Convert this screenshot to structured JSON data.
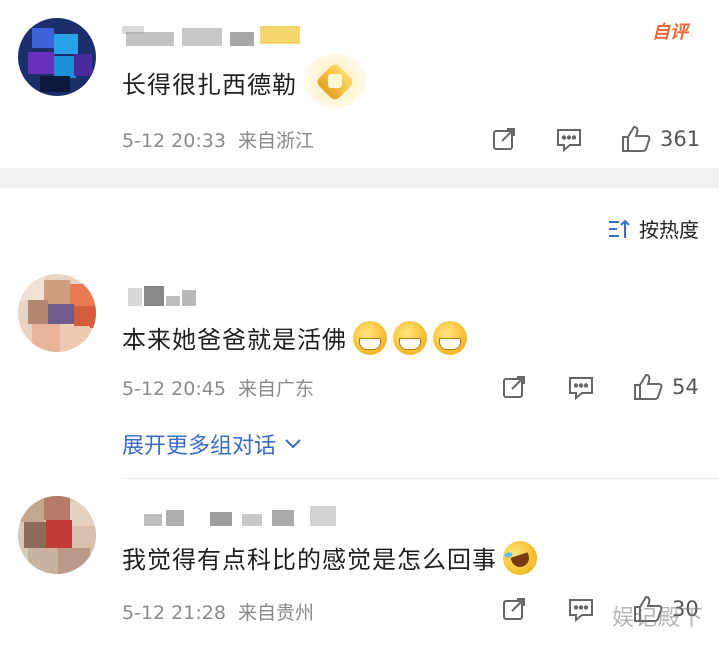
{
  "comments": [
    {
      "text": "长得很扎西德勒",
      "time": "5-12 20:33",
      "location": "来自浙江",
      "likes": "361",
      "hot_label": "自评"
    },
    {
      "text": "本来她爸爸就是活佛",
      "time": "5-12 20:45",
      "location": "来自广东",
      "likes": "54",
      "expand_label": "展开更多组对话"
    },
    {
      "text": "我觉得有点科比的感觉是怎么回事",
      "time": "5-12 21:28",
      "location": "来自贵州",
      "likes": "30"
    }
  ],
  "sort": {
    "label": "按热度"
  },
  "watermark": "娱记殿下",
  "colors": {
    "link": "#3b6cc5",
    "meta": "#8a8a8a",
    "divider": "#f1f1f3",
    "hot": "#e86a3a"
  },
  "icons": [
    "share-icon",
    "comment-icon",
    "like-icon",
    "sort-icon",
    "chevron-down-icon"
  ]
}
